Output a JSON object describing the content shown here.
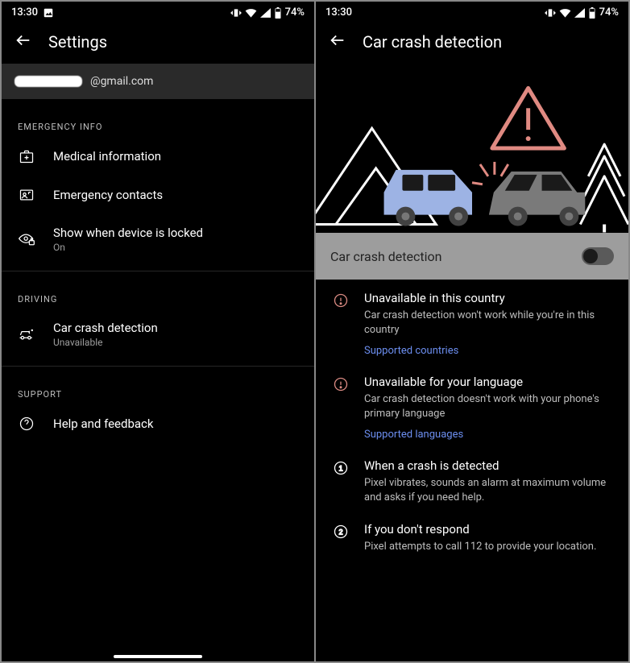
{
  "status": {
    "time": "13:30",
    "battery": "74%"
  },
  "left": {
    "appbar_title": "Settings",
    "account_suffix": "@gmail.com",
    "sections": {
      "emergency": {
        "header": "EMERGENCY INFO",
        "medical": "Medical information",
        "contacts": "Emergency contacts",
        "show_locked": {
          "title": "Show when device is locked",
          "sub": "On"
        }
      },
      "driving": {
        "header": "DRIVING",
        "crash": {
          "title": "Car crash detection",
          "sub": "Unavailable"
        }
      },
      "support": {
        "header": "SUPPORT",
        "help": "Help and feedback"
      }
    }
  },
  "right": {
    "appbar_title": "Car crash detection",
    "toggle_label": "Car crash detection",
    "toggle_on": false,
    "items": {
      "country": {
        "title": "Unavailable in this country",
        "body": "Car crash detection won't work while you're in this country",
        "link": "Supported countries"
      },
      "language": {
        "title": "Unavailable for your language",
        "body": "Car crash detection doesn't work with your phone's primary language",
        "link": "Supported languages"
      },
      "detected": {
        "title": "When a crash is detected",
        "body": "Pixel vibrates, sounds an alarm at maximum volume and asks if you need help."
      },
      "respond": {
        "title": "If you don't respond",
        "body": "Pixel attempts to call 112 to provide your location."
      }
    }
  }
}
